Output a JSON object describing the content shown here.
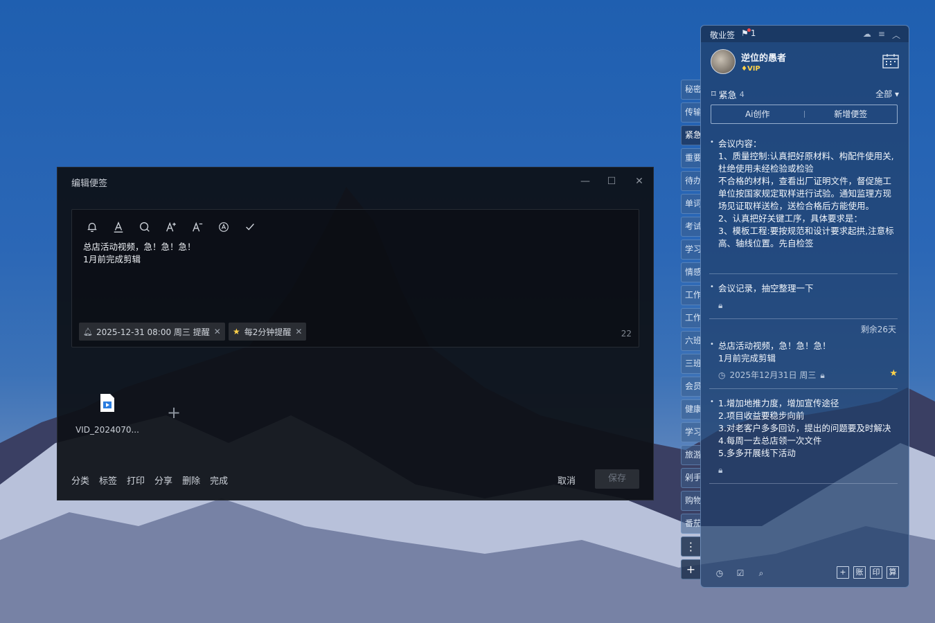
{
  "editor": {
    "title": "编辑便签",
    "content_lines": [
      "总店活动视频，急！急！急！",
      "1月前完成剪辑"
    ],
    "reminder_chip": "2025-12-31 08:00 周三 提醒",
    "repeat_chip": "每2分钟提醒",
    "char_count": "22",
    "attachment_name": "VID_2024070...",
    "actions": [
      "分类",
      "标签",
      "打印",
      "分享",
      "删除",
      "完成"
    ],
    "cancel": "取消",
    "save": "保存"
  },
  "tabs": [
    "秘密",
    "传输",
    "紧急",
    "重要",
    "待办",
    "单词",
    "考试",
    "学习",
    "情感",
    "工作",
    "工作",
    "六班",
    "三班",
    "会员",
    "健康",
    "学习",
    "旅游",
    "剁手",
    "购物",
    "番茄"
  ],
  "panel": {
    "app_name": "敬业签",
    "notif_count": "1",
    "username": "逆位的愚者",
    "vip": "VIP",
    "category": "紧急",
    "category_count": "4",
    "filter": "全部",
    "ai_create": "Ai创作",
    "new_note": "新增便签",
    "notes": [
      {
        "lines": [
          "会议内容：",
          "1、质量控制:认真把好原材料、构配件使用关,杜绝使用未经检验或检验",
          "不合格的材料，查看出厂证明文件，督促施工单位按国家规定取样进行试验。通知监理方现场见证取样送检，送检合格后方能使用。",
          "2、认真把好关键工序，具体要求是：",
          "3、模板工程:要按规范和设计要求起拱,注意标高、轴线位置。先自检签"
        ]
      },
      {
        "lines": [
          "会议记录，抽空整理一下"
        ]
      },
      {
        "remaining": "剩余26天",
        "lines": [
          "总店活动视频，急！急！急！",
          "1月前完成剪辑"
        ],
        "date": "2025年12月31日 周三"
      },
      {
        "lines": [
          "1.增加地推力度，增加宣传途径",
          "2.项目收益要稳步向前",
          "3.对老客户多多回访，提出的问题要及时解决",
          "4.每周一去总店领一次文件",
          "5.多多开展线下活动"
        ]
      }
    ],
    "footer_boxes": [
      "账",
      "印",
      "算"
    ]
  }
}
